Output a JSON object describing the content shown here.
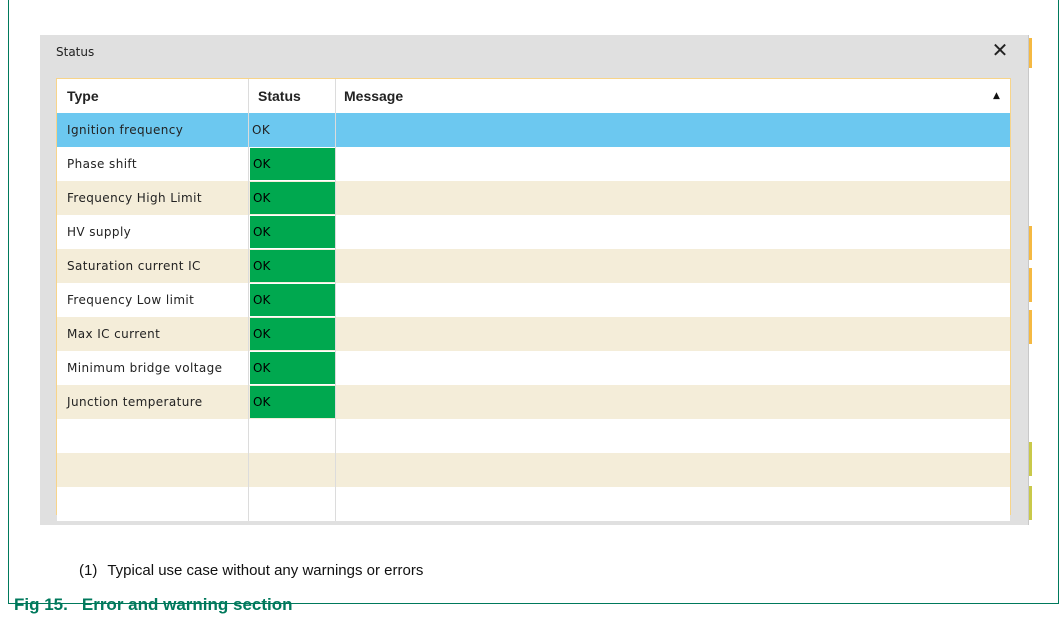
{
  "dialog": {
    "title": "Status",
    "close_icon": "close-icon",
    "columns": {
      "type": "Type",
      "status": "Status",
      "message": "Message"
    },
    "sort_icon": "sort-ascending-icon",
    "rows": [
      {
        "type": "Ignition frequency",
        "status": "OK",
        "message": "",
        "selected": true
      },
      {
        "type": "Phase shift",
        "status": "OK",
        "message": ""
      },
      {
        "type": "Frequency High Limit",
        "status": "OK",
        "message": ""
      },
      {
        "type": "HV supply",
        "status": "OK",
        "message": ""
      },
      {
        "type": "Saturation current IC",
        "status": "OK",
        "message": ""
      },
      {
        "type": "Frequency Low limit",
        "status": "OK",
        "message": ""
      },
      {
        "type": "Max IC current",
        "status": "OK",
        "message": ""
      },
      {
        "type": "Minimum bridge voltage",
        "status": "OK",
        "message": ""
      },
      {
        "type": "Junction temperature",
        "status": "OK",
        "message": ""
      }
    ]
  },
  "colors": {
    "row_odd": "#f4edd9",
    "row_even": "#ffffff",
    "row_selected": "#6cc8f0",
    "status_ok": "#00a84f",
    "fig_title": "#00795c"
  },
  "caption": {
    "number": "(1)",
    "text": "Typical use case without any warnings or errors"
  },
  "figure": {
    "label": "Fig 15.",
    "title": "Error and warning section"
  }
}
